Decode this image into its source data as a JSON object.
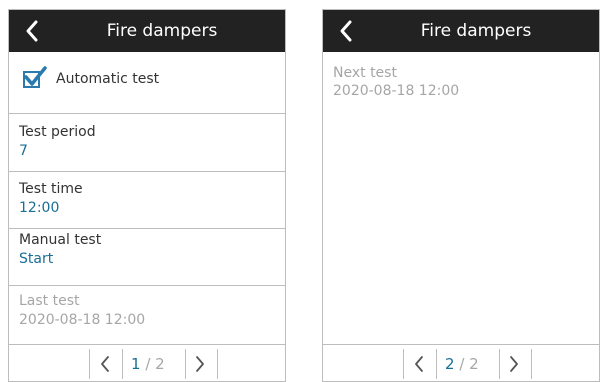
{
  "screens": [
    {
      "title": "Fire dampers",
      "automatic_test": {
        "label": "Automatic test",
        "checked": true
      },
      "test_period": {
        "label": "Test period",
        "value": "7"
      },
      "test_time": {
        "label": "Test time",
        "value": "12:00"
      },
      "manual_test": {
        "label": "Manual test",
        "value": "Start"
      },
      "last_test": {
        "label": "Last test",
        "value": "2020-08-18 12:00"
      },
      "pager": {
        "current": "1",
        "separator": " / ",
        "total": "2"
      }
    },
    {
      "title": "Fire dampers",
      "next_test": {
        "label": "Next test",
        "value": "2020-08-18 12:00"
      },
      "pager": {
        "current": "2",
        "separator": " / ",
        "total": "2"
      }
    }
  ],
  "icons": {
    "back": "chevron-left-icon",
    "check": "checkmark-icon",
    "prev_page": "chevron-left-icon",
    "next_page": "chevron-right-icon"
  },
  "colors": {
    "header_bg": "#222222",
    "accent": "#1a6e96",
    "checkbox": "#2a7ab0",
    "disabled_text": "#a6a6a6",
    "divider": "#bdbdbd"
  }
}
